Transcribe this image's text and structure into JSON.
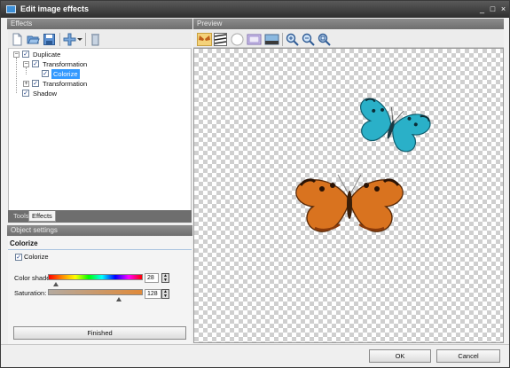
{
  "window": {
    "title": "Edit image effects",
    "controls": [
      "_",
      "□",
      "×"
    ]
  },
  "effects_panel": {
    "header": "Effects",
    "toolbar_icons": [
      "new-icon",
      "open-folder-icon",
      "save-icon",
      "add-effect-icon",
      "dropdown-arrow-icon",
      "delete-icon"
    ],
    "tree": [
      {
        "label": "Duplicate",
        "checked": true,
        "expander": "−"
      },
      {
        "label": "Transformation",
        "checked": true,
        "expander": "−"
      },
      {
        "label": "Colorize",
        "checked": true,
        "selected": true
      },
      {
        "label": "Transformation",
        "checked": true,
        "expander": "+"
      },
      {
        "label": "Shadow",
        "checked": true
      }
    ],
    "tabs": [
      {
        "label": "Tools",
        "active": false
      },
      {
        "label": "Effects",
        "active": true
      }
    ]
  },
  "object_settings": {
    "header": "Object settings",
    "title": "Colorize",
    "colorize_checkbox_label": "Colorize",
    "colorize_checked": true,
    "color_shade": {
      "label": "Color shade:",
      "value": "28"
    },
    "saturation": {
      "label": "Saturation:",
      "value": "128"
    },
    "finished_button": "Finished"
  },
  "preview": {
    "header": "Preview",
    "toolbar_icons": [
      "butterfly-icon",
      "zebra-pattern-icon",
      "white-circle-icon",
      "frame-icon",
      "landscape-icon",
      "zoom-in-icon",
      "zoom-out-icon",
      "zoom-fit-icon"
    ]
  },
  "footer": {
    "ok_button": "OK",
    "cancel_button": "Cancel"
  },
  "colors": {
    "accent": "#3399ff",
    "titlebar": "#3d3d3d",
    "saturation_bar": "#e08a3a",
    "butterfly_cyan": "#2ab0c8",
    "butterfly_orange": "#d9731f"
  }
}
